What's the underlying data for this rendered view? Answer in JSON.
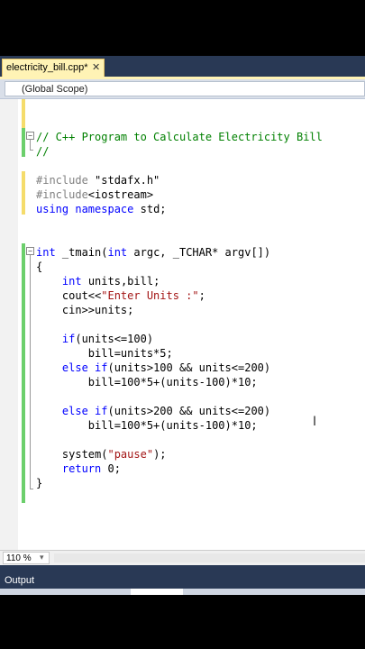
{
  "tab": {
    "filename": "electricity_bill.cpp*",
    "close": "✕"
  },
  "scope": {
    "label": "(Global Scope)"
  },
  "code_lines": [
    "",
    "",
    "// C++ Program to Calculate Electricity Bill",
    "//",
    "",
    "#include \"stdafx.h\"",
    "#include<iostream>",
    "using namespace std;",
    "",
    "",
    "int _tmain(int argc, _TCHAR* argv[])",
    "{",
    "    int units,bill;",
    "    cout<<\"Enter Units :\";",
    "    cin>>units;",
    "",
    "    if(units<=100)",
    "        bill=units*5;",
    "    else if(units>100 && units<=200)",
    "        bill=100*5+(units-100)*10;",
    "",
    "    else if(units>200 && units<=200)",
    "        bill=100*5+(units-100)*10;",
    "",
    "    system(\"pause\");",
    "    return 0;",
    "}"
  ],
  "statusbar": {
    "zoom": "110 %"
  },
  "output": {
    "label": "Output"
  },
  "colors": {
    "keyword": "#0000ff",
    "comment": "#008000",
    "string": "#a31515",
    "preprocessor": "#808080",
    "ide_frame": "#293955",
    "active_tab": "#fff3b5"
  }
}
